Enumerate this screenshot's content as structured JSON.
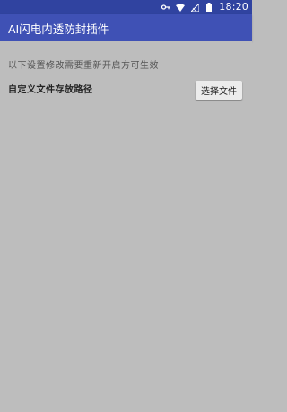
{
  "status_bar": {
    "time": "18:20",
    "icons": [
      "key-icon",
      "wifi-icon",
      "signal-icon",
      "battery-icon"
    ]
  },
  "app_bar": {
    "title": "AI闪电内透防封插件"
  },
  "settings": {
    "notice": "以下设置修改需要重新开启方可生效",
    "custom_path_label": "自定义文件存放路径",
    "choose_file_button": "选择文件"
  },
  "colors": {
    "status_bar": "#3043a0",
    "app_bar": "#3f51b5",
    "background": "#bdbdbd",
    "button": "#ececec"
  }
}
